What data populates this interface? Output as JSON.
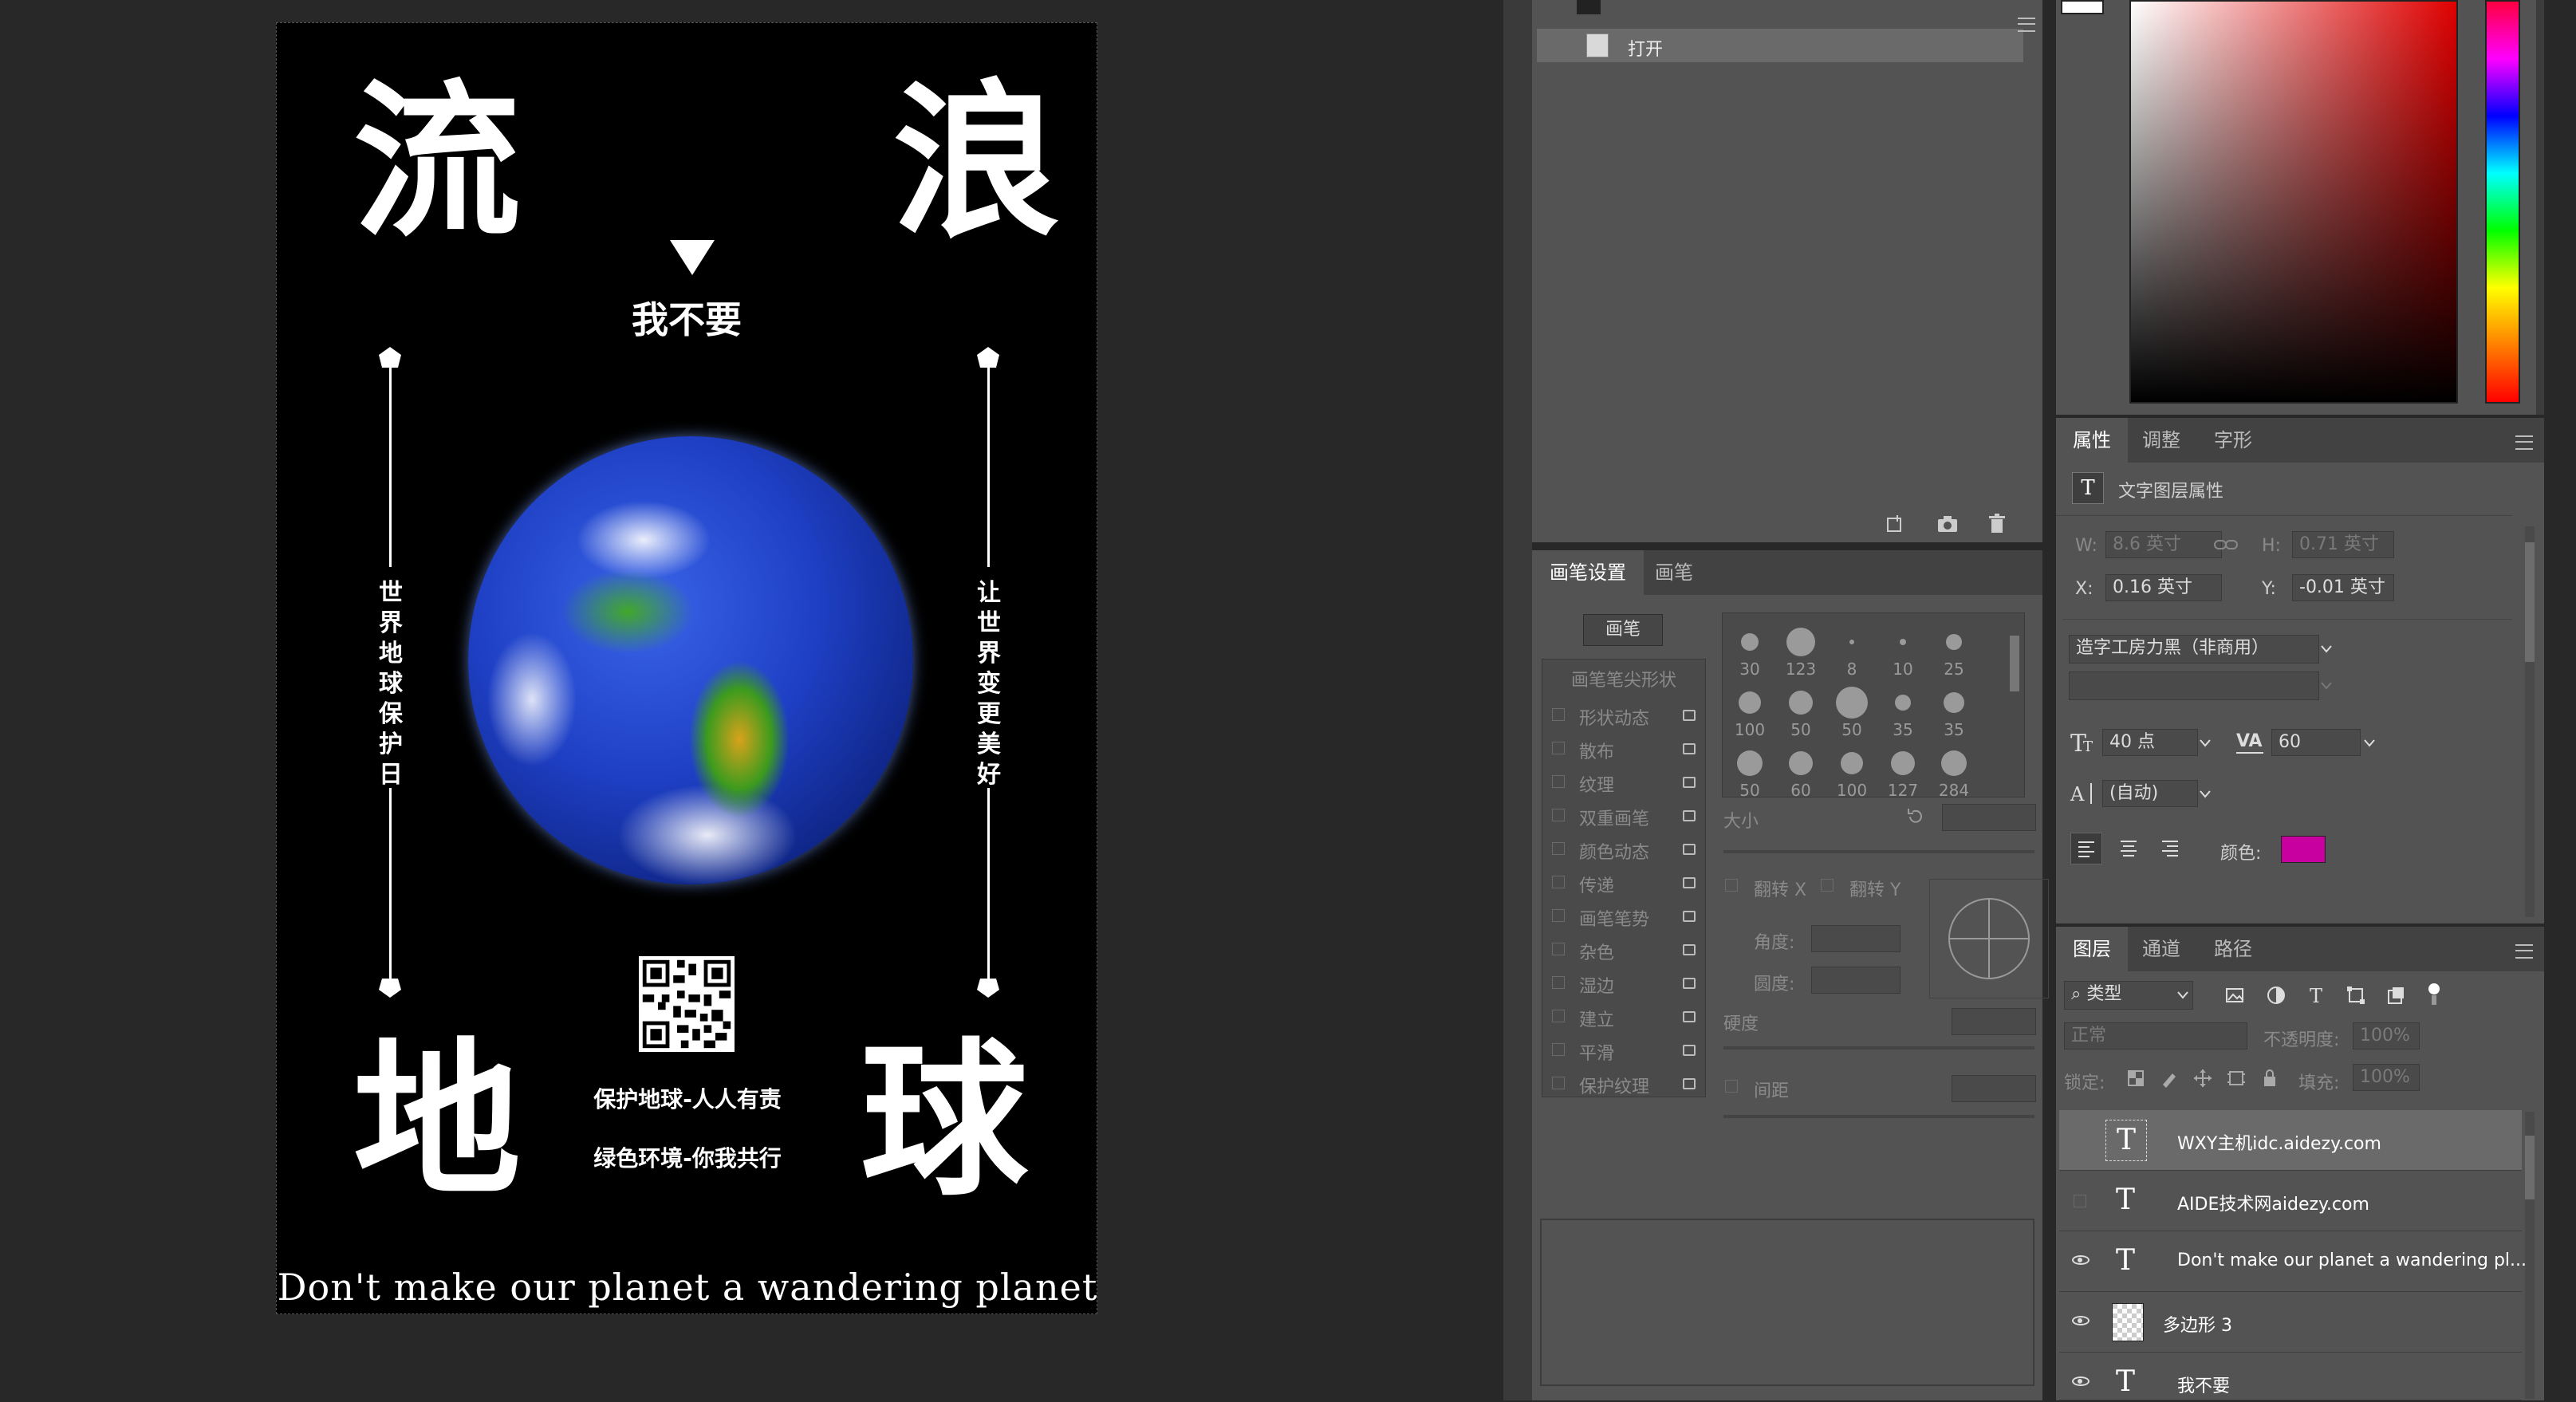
{
  "poster": {
    "char_tl": "流",
    "char_tr": "浪",
    "char_bl": "地",
    "char_br": "球",
    "subtitle": "我不要",
    "left_vertical": "世界地球保护日",
    "right_vertical": "让世界变更美好",
    "slogan1": "保护地球-人人有责",
    "slogan2": "绿色环境-你我共行",
    "bottom_en": "Don't make our planet a wandering planet"
  },
  "history": {
    "open_item": "打开"
  },
  "color_panel": {
    "accent": "#c800a0"
  },
  "properties": {
    "tabs": [
      "属性",
      "调整",
      "字形"
    ],
    "header": "文字图层属性",
    "w_label": "W:",
    "w_value": "8.6 英寸",
    "h_label": "H:",
    "h_value": "0.71 英寸",
    "x_label": "X:",
    "x_value": "0.16 英寸",
    "y_label": "Y:",
    "y_value": "-0.01 英寸",
    "font": "造字工房力黑（非商用）",
    "size": "40 点",
    "tracking": "60",
    "leading": "(自动)",
    "color_label": "颜色:",
    "color": "#c800a0"
  },
  "brush": {
    "tabs": [
      "画笔设置",
      "画笔"
    ],
    "brush_button": "画笔",
    "tip_shape": "画笔笔尖形状",
    "options": [
      "形状动态",
      "散布",
      "纹理",
      "双重画笔",
      "颜色动态",
      "传递",
      "画笔笔势",
      "杂色",
      "湿边",
      "建立",
      "平滑",
      "保护纹理"
    ],
    "sizes": [
      "30",
      "123",
      "8",
      "10",
      "25",
      "100",
      "50",
      "50",
      "35",
      "35",
      "50",
      "60",
      "100",
      "127",
      "284"
    ],
    "size_label": "大小",
    "flip_x": "翻转 X",
    "flip_y": "翻转 Y",
    "angle_label": "角度:",
    "roundness_label": "圆度:",
    "hardness_label": "硬度",
    "spacing_label": "间距"
  },
  "layers": {
    "tabs": [
      "图层",
      "通道",
      "路径"
    ],
    "filter": "类型",
    "blend": "正常",
    "opacity_label": "不透明度:",
    "opacity": "100%",
    "lock_label": "锁定:",
    "fill_label": "填充:",
    "fill": "100%",
    "items": [
      {
        "name": "WXY主机idc.aidezy.com"
      },
      {
        "name": "AIDE技术网aidezy.com"
      },
      {
        "name": "Don't make our planet a wandering pl..."
      },
      {
        "name": "多边形 3"
      },
      {
        "name": "我不要"
      }
    ]
  }
}
